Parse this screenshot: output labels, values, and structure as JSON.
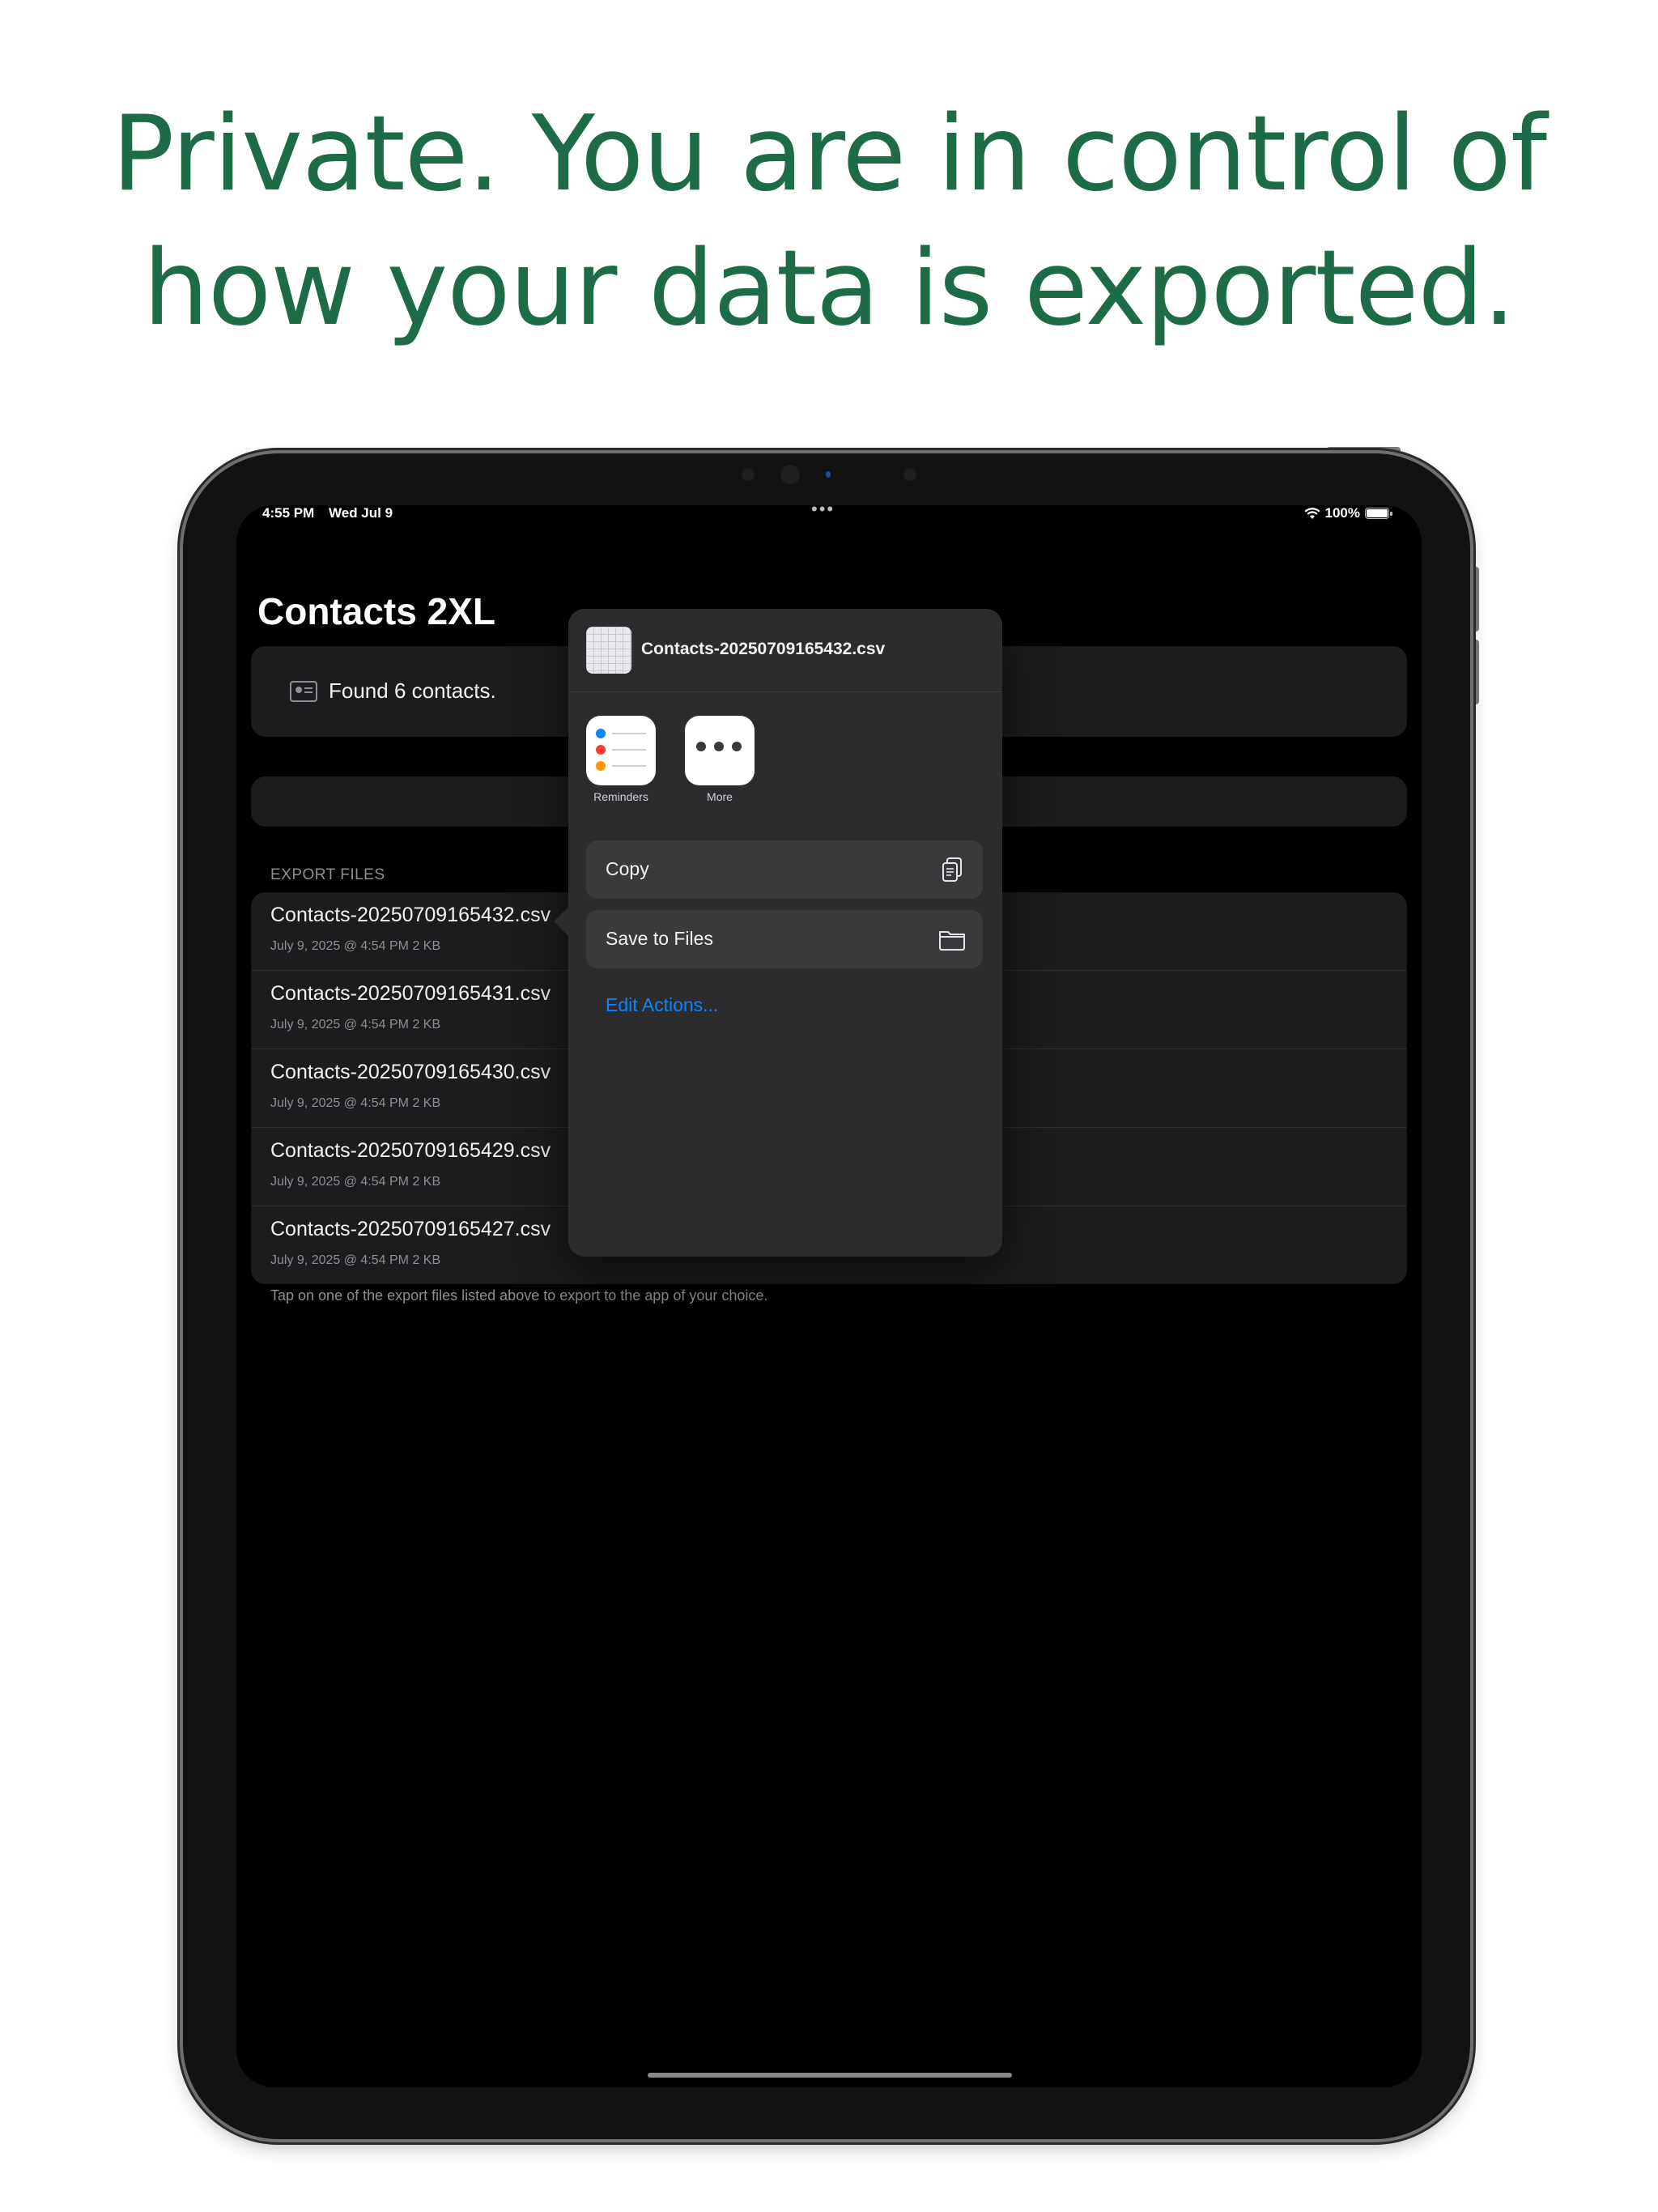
{
  "headline": {
    "line1": "Private. You are in control of",
    "line2": "how your data is exported."
  },
  "status_bar": {
    "time": "4:55 PM",
    "date": "Wed Jul 9",
    "battery": "100%"
  },
  "app": {
    "title": "Contacts 2XL",
    "found_text": "Found 6 contacts.",
    "section_label": "EXPORT FILES",
    "footer_note": "Tap on one of the export files listed above to export to the app of your choice.",
    "files": [
      {
        "name": "Contacts-20250709165432.csv",
        "meta": "July 9, 2025 @ 4:54 PM   2 KB"
      },
      {
        "name": "Contacts-20250709165431.csv",
        "meta": "July 9, 2025 @ 4:54 PM   2 KB"
      },
      {
        "name": "Contacts-20250709165430.csv",
        "meta": "July 9, 2025 @ 4:54 PM   2 KB"
      },
      {
        "name": "Contacts-20250709165429.csv",
        "meta": "July 9, 2025 @ 4:54 PM   2 KB"
      },
      {
        "name": "Contacts-20250709165427.csv",
        "meta": "July 9, 2025 @ 4:54 PM   2 KB"
      }
    ]
  },
  "share_sheet": {
    "filename": "Contacts-20250709165432.csv",
    "apps": [
      {
        "label": "Reminders",
        "icon": "reminders-icon"
      },
      {
        "label": "More",
        "icon": "more-icon"
      }
    ],
    "actions": [
      {
        "label": "Copy",
        "icon": "copy-icon"
      },
      {
        "label": "Save to Files",
        "icon": "folder-icon"
      }
    ],
    "edit_actions": "Edit Actions..."
  },
  "colors": {
    "headline": "#1e6b47",
    "link": "#0a84ff",
    "sheet_bg": "#2c2c2e",
    "card_bg": "#1c1c1e"
  }
}
